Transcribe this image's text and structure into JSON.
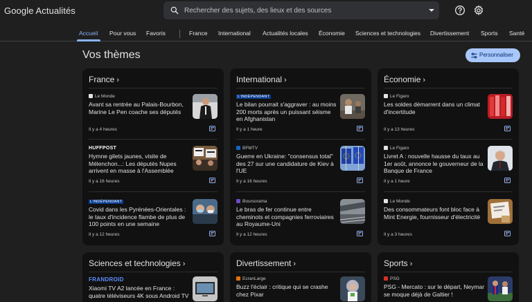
{
  "header": {
    "logo_google": "Google",
    "logo_product": "Actualités",
    "search_placeholder": "Rechercher des sujets, des lieux et des sources"
  },
  "nav": {
    "items": [
      "Accueil",
      "Pour vous",
      "Favoris",
      "France",
      "International",
      "Actualités locales",
      "Économie",
      "Sciences et technologies",
      "Divertissement",
      "Sports",
      "Santé"
    ],
    "active": "Accueil"
  },
  "main": {
    "title": "Vos thèmes",
    "personalize_label": "Personnaliser"
  },
  "sections": [
    {
      "title": "France",
      "articles": [
        {
          "source": "Le Monde",
          "headline": "Avant sa rentrée au Palais-Bourbon, Marine Le Pen coache ses députés",
          "time": "Il y a 4 heures",
          "thumb": "person-dark-suit"
        },
        {
          "source": "HUFFPOST",
          "headline": "Hymne gilets jaunes, visite de Mélenchon...: Les députés Nupes arrivent en masse à l'Assemblée",
          "time": "Il y a 16 heures",
          "thumb": "protest-signs"
        },
        {
          "source": "L'INDÉPENDANT",
          "headline": "Covid dans les Pyrénées-Orientales : le taux d'incidence flambe de plus de 100 points en une semaine",
          "time": "Il y a 12 heures",
          "thumb": "masked-people"
        }
      ]
    },
    {
      "title": "International",
      "articles": [
        {
          "source": "L'INDÉPENDANT",
          "headline": "Le bilan pourrait s'aggraver : au moins 200 morts après un puissant séisme en Afghanistan",
          "time": "Il y a 1 heure",
          "thumb": "earthquake-rubble"
        },
        {
          "source": "BFMTV",
          "headline": "Guerre en Ukraine: \"consensus total\" des 27 sur une candidature de Kiev à l'UE",
          "time": "Il y a 16 heures",
          "thumb": "eu-flags"
        },
        {
          "source": "Boursorama",
          "headline": "Le bras de fer continue entre cheminots et compagnies ferroviaires au Royaume-Uni",
          "time": "Il y a 12 heures",
          "thumb": "train-station"
        }
      ]
    },
    {
      "title": "Économie",
      "articles": [
        {
          "source": "Le Figaro",
          "headline": "Les soldes démarrent dans un climat d'incertitude",
          "time": "Il y a 13 heures",
          "thumb": "red-sale-clothes"
        },
        {
          "source": "Le Figaro",
          "headline": "Livret A : nouvelle hausse du taux au 1er août, annonce le gouverneur de la Banque de France",
          "time": "Il y a 1 heure",
          "thumb": "governor-portrait"
        },
        {
          "source": "Le Monde",
          "headline": "Des consommateurs font bloc face à Mint Energie, fournisseur d'électricité",
          "time": "Il y a 3 heures",
          "thumb": "energy-bill"
        }
      ]
    },
    {
      "title": "Sciences et technologies",
      "articles": [
        {
          "source": "FRANDROID",
          "headline": "Xiaomi TV A2 lancée en France : quatre téléviseurs 4K sous Android TV",
          "time": "",
          "thumb": "tv-screen"
        }
      ]
    },
    {
      "title": "Divertissement",
      "articles": [
        {
          "source": "EcranLarge",
          "headline": "Buzz l'éclair : critique qui se crashe chez Pixar",
          "time": "",
          "thumb": "buzz-lightyear"
        }
      ]
    },
    {
      "title": "Sports",
      "articles": [
        {
          "source": "PSG",
          "headline": "PSG - Mercato : sur le départ, Neymar se moque déjà de Galtier !",
          "time": "",
          "thumb": "football-players"
        }
      ]
    }
  ],
  "colors": {
    "background": "#1f1f1f",
    "card": "#111111",
    "accent": "#8ab4f8",
    "button": "#a8c7fa"
  }
}
